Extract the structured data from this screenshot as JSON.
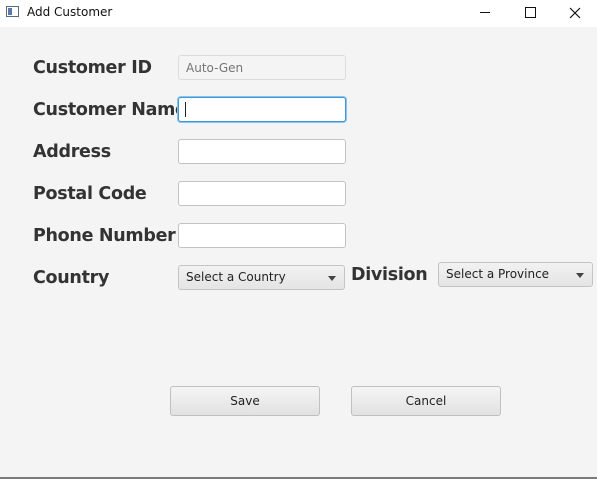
{
  "window": {
    "title": "Add Customer"
  },
  "form": {
    "customer_id": {
      "label": "Customer ID",
      "placeholder": "Auto-Gen",
      "value": ""
    },
    "customer_name": {
      "label": "Customer Name",
      "value": ""
    },
    "address": {
      "label": "Address",
      "value": ""
    },
    "postal_code": {
      "label": "Postal Code",
      "value": ""
    },
    "phone_number": {
      "label": "Phone Number",
      "value": ""
    },
    "country": {
      "label": "Country",
      "selected": "Select a Country"
    },
    "division": {
      "label": "Division",
      "selected": "Select a Province"
    }
  },
  "buttons": {
    "save": "Save",
    "cancel": "Cancel"
  },
  "icons": {
    "app": "app-window-icon",
    "minimize": "minimize-icon",
    "maximize": "maximize-icon",
    "close": "close-icon"
  }
}
